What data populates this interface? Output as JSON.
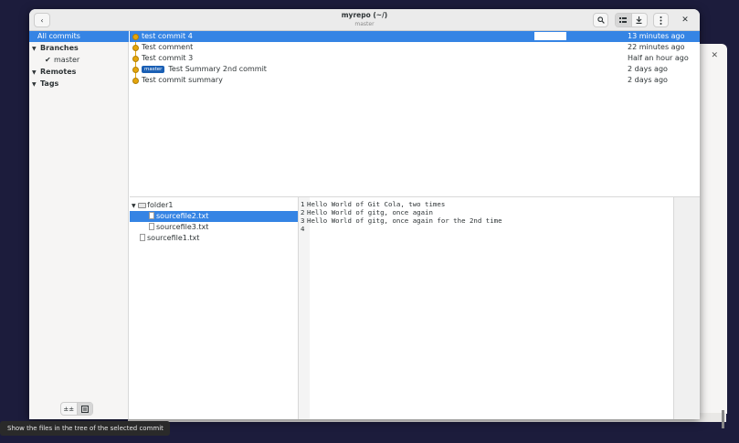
{
  "window": {
    "title": "myrepo (~/)",
    "subtitle": "master"
  },
  "header": {
    "back_icon": "chevron-left-icon",
    "search_icon": "search-icon",
    "list_icon": "list-view-icon",
    "download_icon": "download-icon",
    "menu_icon": "kebab-menu-icon",
    "close_icon": "close-icon"
  },
  "sidebar": {
    "all_commits": "All commits",
    "branches": "Branches",
    "branch_master": "master",
    "remotes": "Remotes",
    "tags": "Tags"
  },
  "commits": [
    {
      "message": "test commit 4",
      "date": "13 minutes ago",
      "badge": ""
    },
    {
      "message": "Test comment",
      "date": "22 minutes ago",
      "badge": ""
    },
    {
      "message": "Test commit 3",
      "date": "Half an hour ago",
      "badge": ""
    },
    {
      "message": "Test Summary 2nd commit",
      "date": "2 days ago",
      "badge": "master"
    },
    {
      "message": "Test commit summary",
      "date": "2 days ago",
      "badge": ""
    }
  ],
  "tree": {
    "folder": "folder1",
    "files_in_folder": [
      "sourcefile2.txt",
      "sourcefile3.txt"
    ],
    "root_files": [
      "sourcefile1.txt"
    ]
  },
  "diff": {
    "lines": [
      {
        "num": "1",
        "text": "Hello World of Git Cola, two times"
      },
      {
        "num": "2",
        "text": "Hello World of gitg, once again"
      },
      {
        "num": "3",
        "text": "Hello World of gitg, once again for the 2nd time"
      },
      {
        "num": "4",
        "text": ""
      }
    ]
  },
  "tooltip": "Show the files in the tree of the selected commit",
  "colors": {
    "accent": "#3584e4",
    "lane": "#e5a50a",
    "badge": "#1a5fb4"
  }
}
